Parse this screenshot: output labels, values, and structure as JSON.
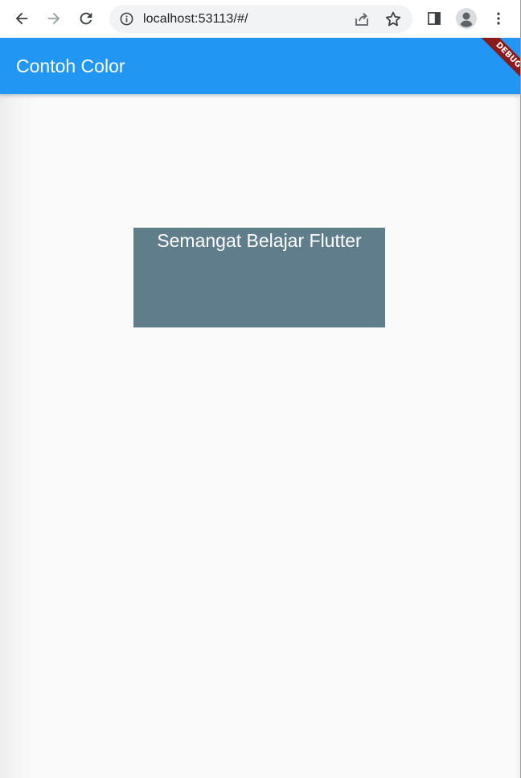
{
  "browser": {
    "url": "localhost:53113/#/",
    "icons": {
      "back": "arrow-back-icon",
      "forward": "arrow-forward-icon",
      "reload": "reload-icon",
      "site_info": "info-icon",
      "share": "share-icon",
      "bookmark": "star-icon",
      "side_panel": "side-panel-icon",
      "profile": "profile-icon",
      "menu": "more-vert-icon"
    }
  },
  "app_bar": {
    "title": "Contoh Color",
    "color": "#2196f3",
    "debug_label": "DEBUG"
  },
  "body": {
    "box_text": "Semangat Belajar Flutter",
    "box_color": "#607d8b"
  }
}
